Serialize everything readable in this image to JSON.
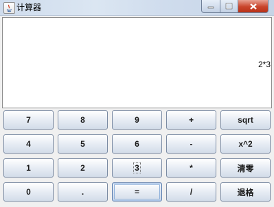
{
  "window": {
    "title": "计算器"
  },
  "display": {
    "value": "2*3"
  },
  "keys": {
    "row1": [
      "7",
      "8",
      "9",
      "+",
      "sqrt"
    ],
    "row2": [
      "4",
      "5",
      "6",
      "-",
      "x^2"
    ],
    "row3": [
      "1",
      "2",
      "3",
      "*",
      "清零"
    ],
    "row4": [
      "0",
      ".",
      "=",
      "/",
      "退格"
    ]
  }
}
